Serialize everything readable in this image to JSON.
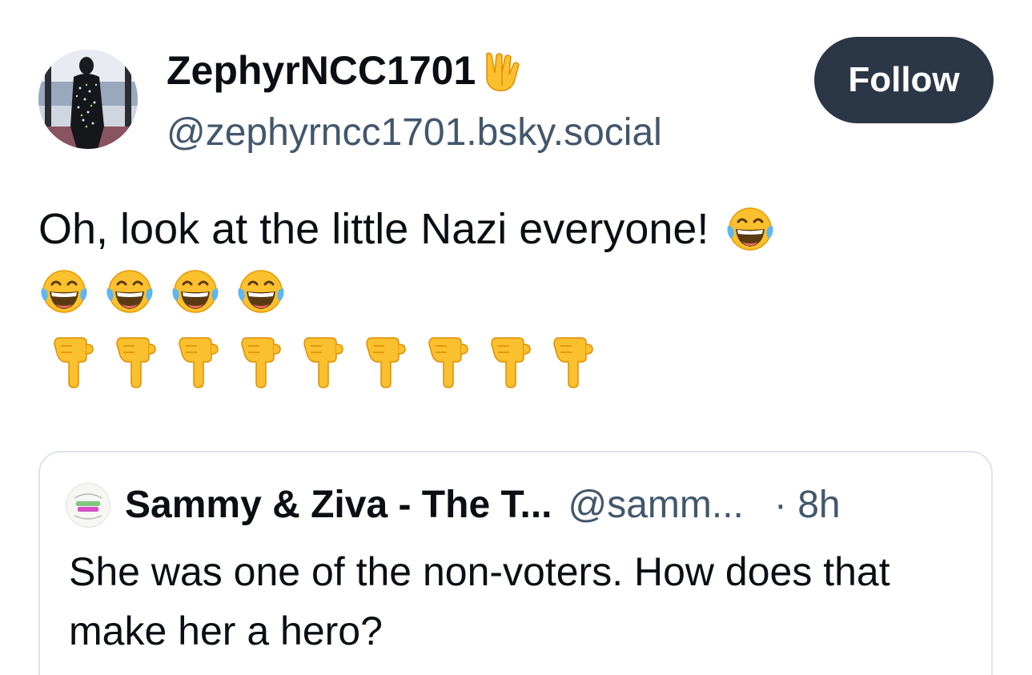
{
  "author": {
    "display_name": "ZephyrNCC1701",
    "name_emoji": "vulcan-salute",
    "handle": "@zephyrncc1701.bsky.social"
  },
  "follow_label": "Follow",
  "post": {
    "text": "Oh, look at the little Nazi everyone!",
    "laugh_emoji_count": 5,
    "point_emoji_count": 9
  },
  "quote": {
    "name": "Sammy & Ziva - The T...",
    "handle": "@samm...",
    "time": "· 8h",
    "text": "She was one of the non-voters. How does that make her a hero?"
  },
  "colors": {
    "follow_bg": "#2b3646",
    "muted_text": "#42576c",
    "emoji_yellow": "#fbc02d"
  }
}
